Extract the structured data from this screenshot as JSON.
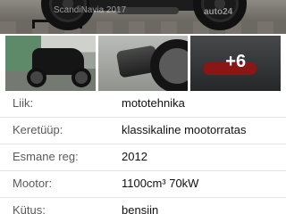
{
  "gallery": {
    "watermark_left": "ScandiNavia 2017",
    "watermark_right": "auto24",
    "more_photos": "+6"
  },
  "specs": [
    {
      "label": "Liik:",
      "value": "mototehnika"
    },
    {
      "label": "Keretüüp:",
      "value": "klassikaline mootorratas"
    },
    {
      "label": "Esmane reg:",
      "value": "2012"
    },
    {
      "label": "Mootor:",
      "value": "1100cm³ 70kW"
    },
    {
      "label": "Kütus:",
      "value": "bensiin"
    }
  ]
}
